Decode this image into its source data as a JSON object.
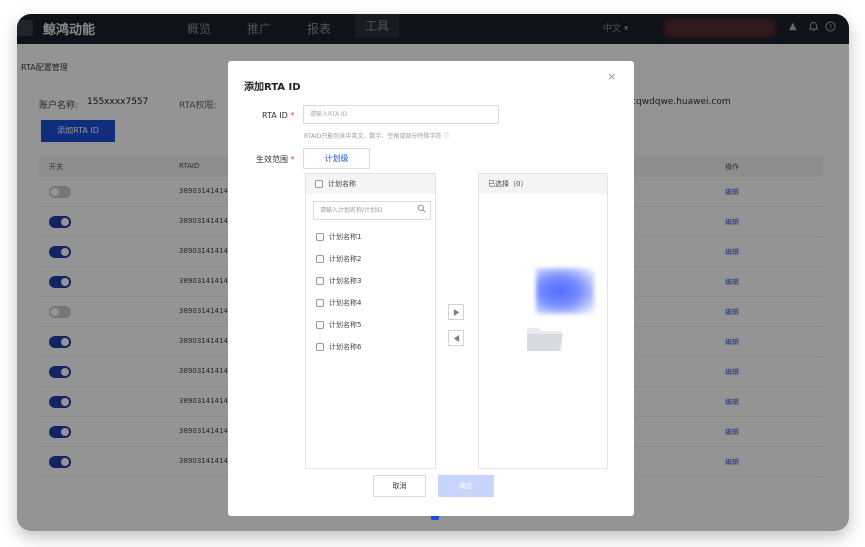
{
  "app": {
    "brand": "鲸鸿动能",
    "nav": [
      "概览",
      "推广",
      "报表",
      "工具"
    ],
    "active_nav_index": 3,
    "language": "中文 ▾",
    "icons": [
      "triangle-up-icon",
      "bell-icon",
      "help-icon"
    ]
  },
  "page": {
    "breadcrumb": "RTA配置管理",
    "account_label": "账户名称:",
    "account_value": "155xxxx7557",
    "rta_perm_label": "RTA权限:",
    "email_partial": "cqwdqwe.huawei.com",
    "add_button": "添加RTA ID",
    "table": {
      "headers": [
        "开关",
        "RTAID",
        "操作"
      ],
      "rows": [
        {
          "enabled": false,
          "id": "389031414141",
          "action": "编辑"
        },
        {
          "enabled": true,
          "id": "389031414141",
          "action": "编辑"
        },
        {
          "enabled": true,
          "id": "389031414141",
          "action": "编辑"
        },
        {
          "enabled": true,
          "id": "389031414141",
          "action": "编辑"
        },
        {
          "enabled": false,
          "id": "389031414141",
          "action": "编辑"
        },
        {
          "enabled": true,
          "id": "389031414141",
          "action": "编辑"
        },
        {
          "enabled": true,
          "id": "389031414141",
          "action": "编辑"
        },
        {
          "enabled": true,
          "id": "389031414141",
          "action": "编辑"
        },
        {
          "enabled": true,
          "id": "389031414141",
          "action": "编辑"
        },
        {
          "enabled": true,
          "id": "389031414141",
          "action": "编辑"
        }
      ]
    }
  },
  "modal": {
    "title": "添加RTA ID",
    "close": "×",
    "rta_id_label": "RTA ID",
    "required_mark": "*",
    "rta_id_placeholder": "请输入RTA ID",
    "rta_hint": "RTAID只能包含中英文、数字、空格或部分特殊字符 ⓘ",
    "scope_label": "生效范围",
    "scope_button": "计划级",
    "left_panel": {
      "header": "计划名称",
      "search_placeholder": "请输入计划名称/计划ID",
      "items": [
        "计划名称1",
        "计划名称2",
        "计划名称3",
        "计划名称4",
        "计划名称5",
        "计划名称6"
      ]
    },
    "right_panel": {
      "header": "已选择（0）"
    },
    "cancel": "取消",
    "confirm": "确定"
  },
  "colors": {
    "primary": "#1e4fd8",
    "topbar": "#1b1f2a",
    "toggle_on": "#1f3fa8",
    "toggle_off": "#c9ccd2",
    "confirm_disabled": "#c7d4fb"
  }
}
